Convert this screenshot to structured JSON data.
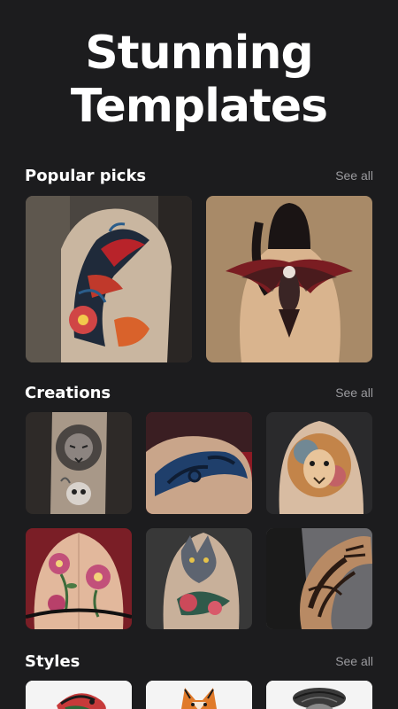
{
  "hero": {
    "line1": "Stunning",
    "line2": "Templates"
  },
  "sections": {
    "popular": {
      "title": "Popular picks",
      "see_all": "See all"
    },
    "creations": {
      "title": "Creations",
      "see_all": "See all"
    },
    "styles": {
      "title": "Styles",
      "see_all": "See all"
    }
  },
  "colors": {
    "background": "#1c1c1e",
    "muted_text": "#9a9a9e",
    "text": "#ffffff"
  }
}
